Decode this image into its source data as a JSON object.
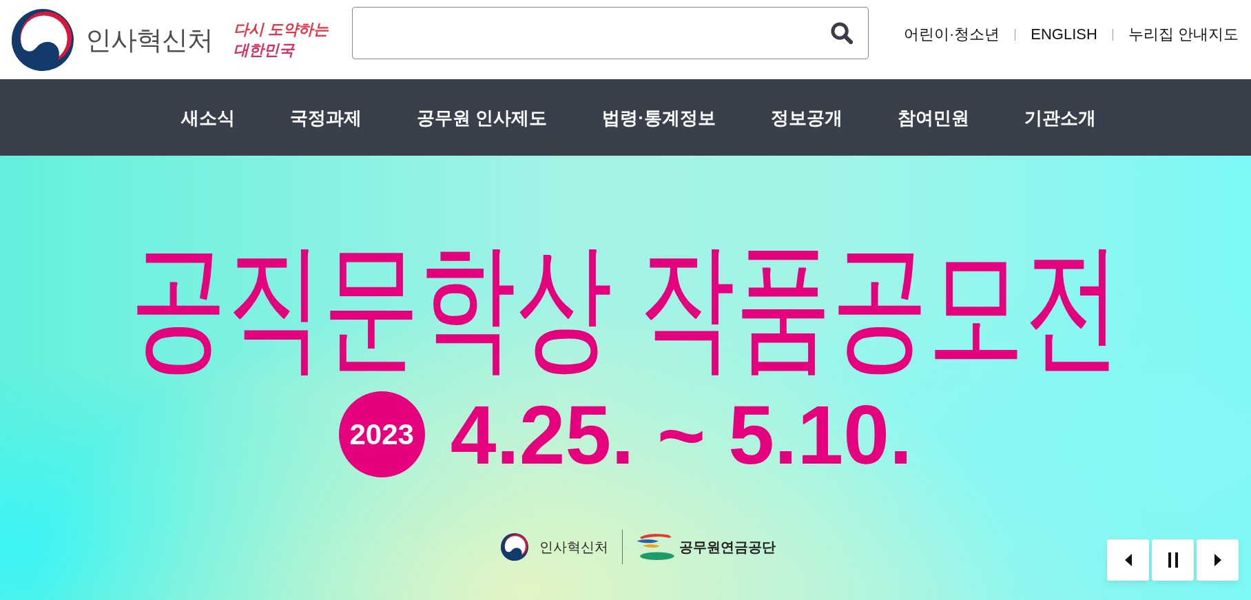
{
  "header": {
    "logo_text": "인사혁신처",
    "slogan": [
      "다시 도약하는",
      "대한민국"
    ],
    "utility_links": [
      "어린이·청소년",
      "ENGLISH",
      "누리집 안내지도"
    ]
  },
  "nav": {
    "items": [
      "새소식",
      "국정과제",
      "공무원 인사제도",
      "법령·통계정보",
      "정보공개",
      "참여민원",
      "기관소개"
    ]
  },
  "banner": {
    "title": "공직문학상 작품공모전",
    "year": "2023",
    "dates": "4.25. ~ 5.10.",
    "partners": [
      {
        "kind": "emblem",
        "name": "인사혁신처"
      },
      {
        "kind": "pension",
        "name": "공무원연금공단"
      }
    ],
    "controls": [
      {
        "kind": "prev"
      },
      {
        "kind": "pause"
      },
      {
        "kind": "next"
      }
    ]
  }
}
